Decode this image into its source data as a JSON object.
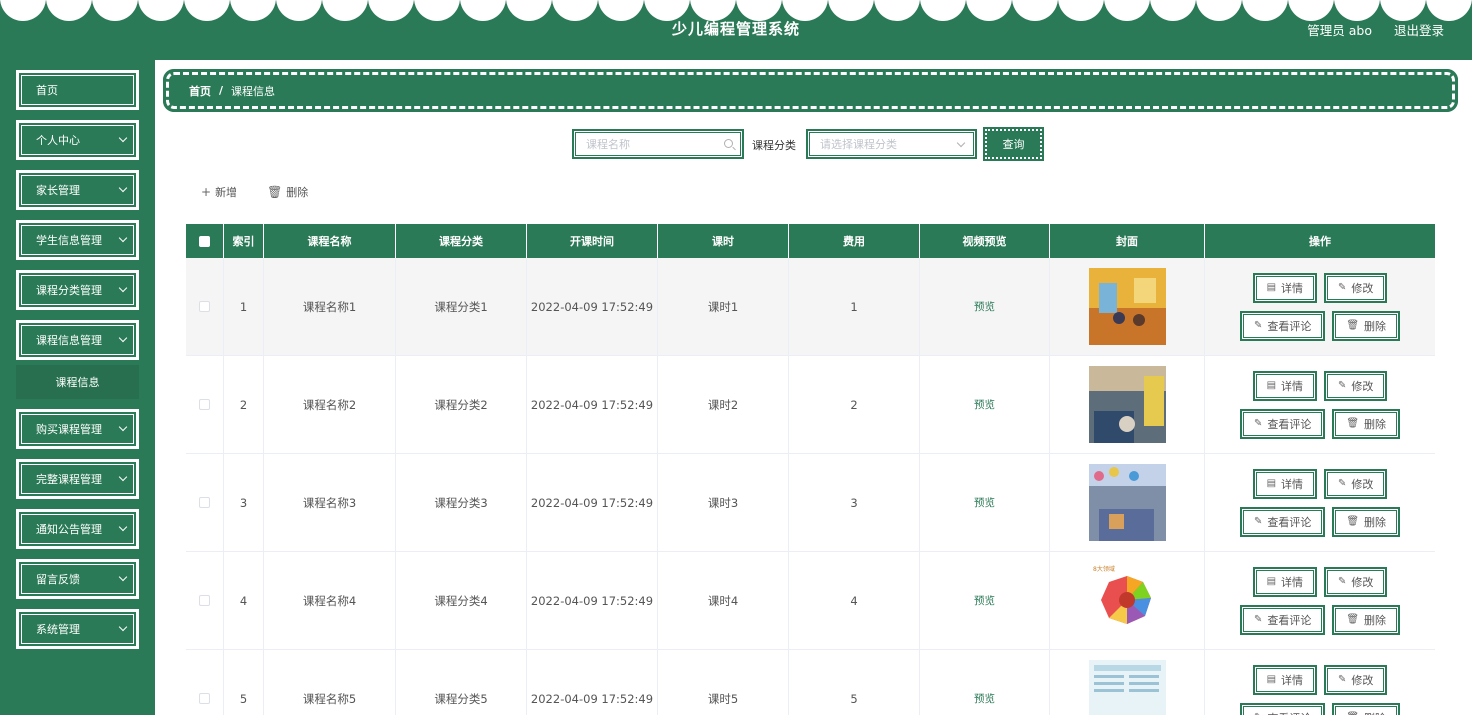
{
  "header": {
    "title": "少儿编程管理系统",
    "user": "管理员 abo",
    "logout": "退出登录"
  },
  "sidebar": {
    "items": [
      {
        "label": "首页",
        "has_arrow": false
      },
      {
        "label": "个人中心",
        "has_arrow": true
      },
      {
        "label": "家长管理",
        "has_arrow": true
      },
      {
        "label": "学生信息管理",
        "has_arrow": true
      },
      {
        "label": "课程分类管理",
        "has_arrow": true
      },
      {
        "label": "课程信息管理",
        "has_arrow": true
      }
    ],
    "submenu": "课程信息",
    "items_after": [
      {
        "label": "购买课程管理"
      },
      {
        "label": "完整课程管理"
      },
      {
        "label": "通知公告管理"
      },
      {
        "label": "留言反馈"
      },
      {
        "label": "系统管理"
      }
    ]
  },
  "breadcrumb": {
    "home": "首页",
    "separator": "/",
    "current": "课程信息"
  },
  "search": {
    "name_placeholder": "课程名称",
    "category_label": "课程分类",
    "category_placeholder": "请选择课程分类",
    "query_button": "查询"
  },
  "toolbar": {
    "add": "新增",
    "delete": "删除"
  },
  "table": {
    "headers": [
      "索引",
      "课程名称",
      "课程分类",
      "开课时间",
      "课时",
      "费用",
      "视频预览",
      "封面",
      "操作"
    ],
    "rows": [
      {
        "index": "1",
        "name": "课程名称1",
        "category": "课程分类1",
        "time": "2022-04-09 17:52:49",
        "hours": "课时1",
        "fee": "1",
        "preview": "预览"
      },
      {
        "index": "2",
        "name": "课程名称2",
        "category": "课程分类2",
        "time": "2022-04-09 17:52:49",
        "hours": "课时2",
        "fee": "2",
        "preview": "预览"
      },
      {
        "index": "3",
        "name": "课程名称3",
        "category": "课程分类3",
        "time": "2022-04-09 17:52:49",
        "hours": "课时3",
        "fee": "3",
        "preview": "预览"
      },
      {
        "index": "4",
        "name": "课程名称4",
        "category": "课程分类4",
        "time": "2022-04-09 17:52:49",
        "hours": "课时4",
        "fee": "4",
        "preview": "预览"
      },
      {
        "index": "5",
        "name": "课程名称5",
        "category": "课程分类5",
        "time": "2022-04-09 17:52:49",
        "hours": "课时5",
        "fee": "5",
        "preview": "预览"
      }
    ],
    "actions": {
      "detail": "详情",
      "edit": "修改",
      "comments": "查看评论",
      "delete": "删除"
    }
  },
  "colors": {
    "primary": "#2b7a57"
  }
}
